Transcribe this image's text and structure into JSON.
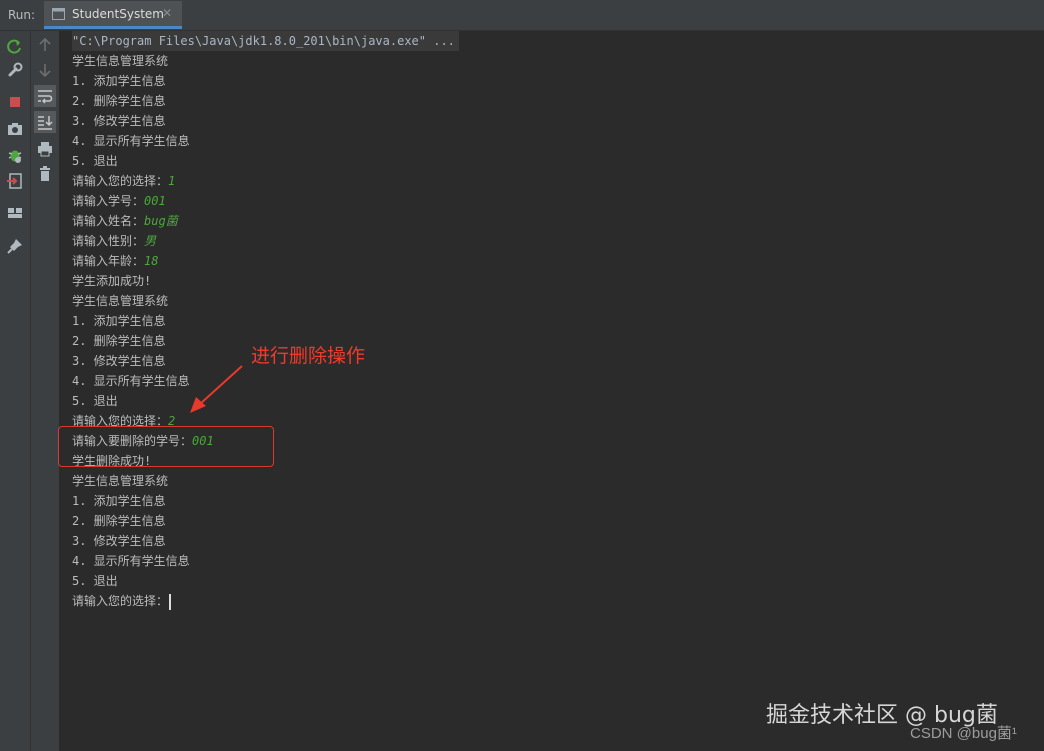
{
  "window": {
    "run_label": "Run:",
    "tab_label": "StudentSystem",
    "tab_close": "✕"
  },
  "toolbar_left": [
    {
      "icon": "rerun-icon"
    },
    {
      "icon": "wrench-icon"
    },
    {
      "icon": "stop-icon"
    },
    {
      "icon": "camera-icon"
    },
    {
      "icon": "debug-bug-icon"
    },
    {
      "icon": "exit-icon"
    },
    {
      "icon": "layout-icon"
    },
    {
      "icon": "pin-icon"
    }
  ],
  "toolbar_second": [
    {
      "icon": "arrow-up-icon"
    },
    {
      "icon": "arrow-down-icon"
    },
    {
      "icon": "soft-wrap-icon"
    },
    {
      "icon": "scroll-to-end-icon"
    },
    {
      "icon": "print-icon"
    },
    {
      "icon": "trash-icon"
    }
  ],
  "console": {
    "command": "\"C:\\Program Files\\Java\\jdk1.8.0_201\\bin\\java.exe\" ...",
    "lines": [
      {
        "text": "学生信息管理系统",
        "input": ""
      },
      {
        "text": "1. 添加学生信息",
        "input": ""
      },
      {
        "text": "2. 删除学生信息",
        "input": ""
      },
      {
        "text": "3. 修改学生信息",
        "input": ""
      },
      {
        "text": "4. 显示所有学生信息",
        "input": ""
      },
      {
        "text": "5. 退出",
        "input": ""
      },
      {
        "text": "请输入您的选择：",
        "input": "1"
      },
      {
        "text": "请输入学号：",
        "input": "001"
      },
      {
        "text": "请输入姓名：",
        "input": "bug菌"
      },
      {
        "text": "请输入性别：",
        "input": "男"
      },
      {
        "text": "请输入年龄：",
        "input": "18"
      },
      {
        "text": "学生添加成功!",
        "input": ""
      },
      {
        "text": "学生信息管理系统",
        "input": ""
      },
      {
        "text": "1. 添加学生信息",
        "input": ""
      },
      {
        "text": "2. 删除学生信息",
        "input": ""
      },
      {
        "text": "3. 修改学生信息",
        "input": ""
      },
      {
        "text": "4. 显示所有学生信息",
        "input": ""
      },
      {
        "text": "5. 退出",
        "input": ""
      },
      {
        "text": "请输入您的选择：",
        "input": "2"
      },
      {
        "text": "请输入要删除的学号：",
        "input": "001"
      },
      {
        "text": "学生删除成功!",
        "input": ""
      },
      {
        "text": "学生信息管理系统",
        "input": ""
      },
      {
        "text": "1. 添加学生信息",
        "input": ""
      },
      {
        "text": "2. 删除学生信息",
        "input": ""
      },
      {
        "text": "3. 修改学生信息",
        "input": ""
      },
      {
        "text": "4. 显示所有学生信息",
        "input": ""
      },
      {
        "text": "5. 退出",
        "input": ""
      },
      {
        "text": "请输入您的选择：",
        "input": ""
      }
    ]
  },
  "annotation": {
    "text": "进行删除操作",
    "color": "#f23a2a"
  },
  "watermark": {
    "main": "掘金技术社区 @ bug菌",
    "sub": "CSDN @bug菌¹"
  },
  "colors": {
    "background": "#2b2b2b",
    "toolbar": "#3c3f41",
    "console_text": "#bcbcbc",
    "user_input": "#4ea63e",
    "highlight_border": "#d83a2f"
  }
}
